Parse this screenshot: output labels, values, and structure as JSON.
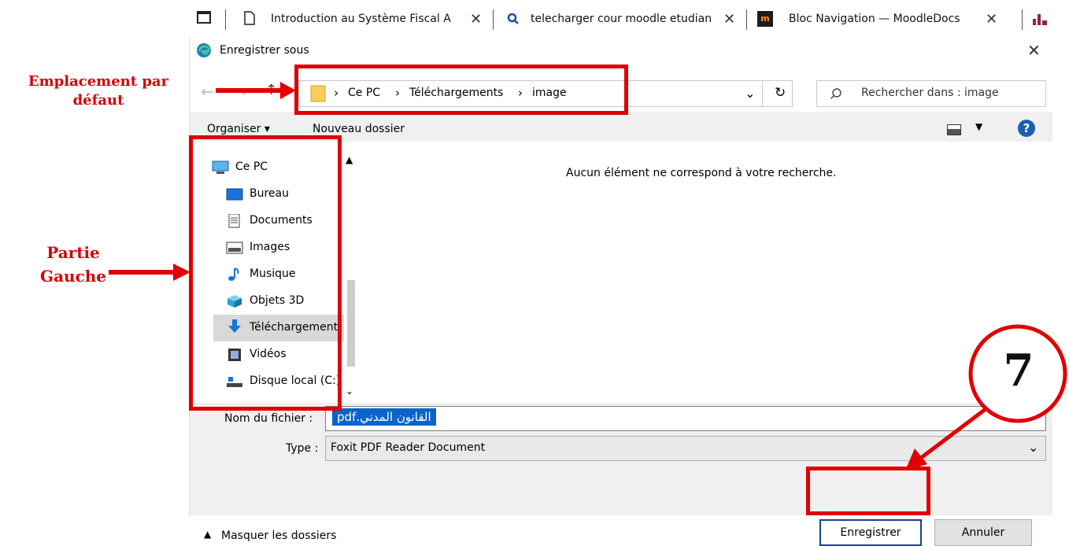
{
  "browser": {
    "tabs": [
      {
        "label": "Introduction au Système Fiscal A",
        "icon": "page-icon"
      },
      {
        "label": "telecharger cour moodle etudian",
        "icon": "search-icon"
      },
      {
        "label": "Bloc Navigation — MoodleDocs",
        "icon": "moodle-icon"
      }
    ],
    "close_glyph": "✕"
  },
  "dialog": {
    "title": "Enregistrer sous",
    "close_glyph": "✕",
    "breadcrumb": [
      "Ce PC",
      "Téléchargements",
      "image"
    ],
    "breadcrumb_sep": "›",
    "search_placeholder": "Rechercher dans : image",
    "toolbar": {
      "organiser": "Organiser ▾",
      "nouveau_dossier": "Nouveau dossier"
    },
    "nav_items": [
      {
        "label": "Ce PC",
        "icon": "computer-icon"
      },
      {
        "label": "Bureau",
        "icon": "desktop-icon"
      },
      {
        "label": "Documents",
        "icon": "documents-icon"
      },
      {
        "label": "Images",
        "icon": "images-icon"
      },
      {
        "label": "Musique",
        "icon": "music-icon"
      },
      {
        "label": "Objets 3D",
        "icon": "objects-3d-icon"
      },
      {
        "label": "Téléchargement",
        "icon": "download-icon"
      },
      {
        "label": "Vidéos",
        "icon": "videos-icon"
      },
      {
        "label": "Disque local (C:)",
        "icon": "drive-icon"
      }
    ],
    "empty_message": "Aucun élément ne correspond à votre recherche.",
    "filename_label": "Nom du fichier :",
    "filename_value": "القانون المدني.pdf",
    "type_label": "Type :",
    "type_value": "Foxit PDF Reader Document",
    "hide_folders": "Masquer les dossiers",
    "save_button": "Enregistrer",
    "cancel_button": "Annuler"
  },
  "annotations": {
    "default_location_line1": "Emplacement par",
    "default_location_line2": "défaut",
    "left_part_line1": "Partie",
    "left_part_line2": "Gauche",
    "step_number": "7"
  },
  "colors": {
    "annotation_red": "#e00000",
    "selection_blue": "#0a64c8",
    "help_blue": "#1a5fb4",
    "folder_yellow": "#f7cf5a"
  }
}
